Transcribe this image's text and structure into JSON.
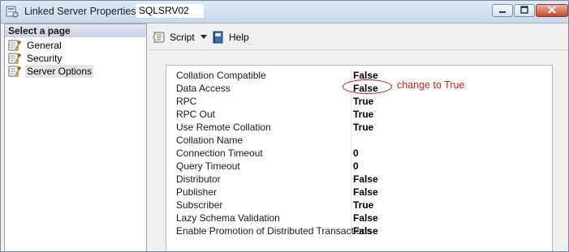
{
  "window": {
    "title": "Linked Server Properties -",
    "server_name": "SQLSRV02"
  },
  "left_pane": {
    "header": "Select a page",
    "items": [
      {
        "label": "General",
        "icon": "page-wrench-icon"
      },
      {
        "label": "Security",
        "icon": "page-wrench-icon"
      },
      {
        "label": "Server Options",
        "icon": "page-wrench-icon",
        "selected": true
      }
    ]
  },
  "toolbar": {
    "script_label": "Script",
    "help_label": "Help"
  },
  "properties": [
    {
      "name": "Collation Compatible",
      "value": "False"
    },
    {
      "name": "Data Access",
      "value": "False"
    },
    {
      "name": "RPC",
      "value": "True"
    },
    {
      "name": "RPC Out",
      "value": "True"
    },
    {
      "name": "Use Remote Collation",
      "value": "True"
    },
    {
      "name": "Collation Name",
      "value": ""
    },
    {
      "name": "Connection Timeout",
      "value": "0"
    },
    {
      "name": "Query Timeout",
      "value": "0"
    },
    {
      "name": "Distributor",
      "value": "False"
    },
    {
      "name": "Publisher",
      "value": "False"
    },
    {
      "name": "Subscriber",
      "value": "True"
    },
    {
      "name": "Lazy Schema Validation",
      "value": "False"
    },
    {
      "name": "Enable Promotion of Distributed Transactions",
      "value": "False"
    }
  ],
  "annotation": {
    "text": "change to True",
    "color": "#d61d1d"
  }
}
